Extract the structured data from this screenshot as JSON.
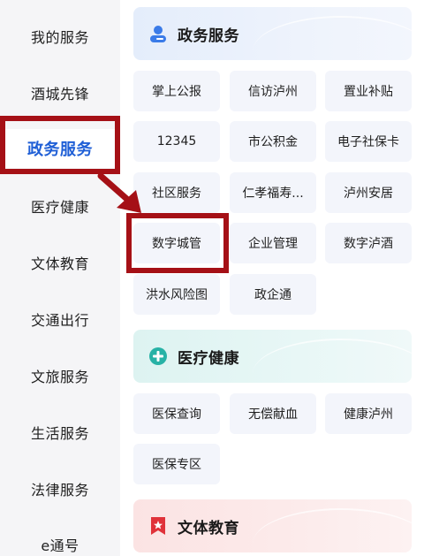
{
  "sidebar": {
    "items": [
      {
        "label": "我的服务"
      },
      {
        "label": "酒城先锋"
      },
      {
        "label": "政务服务"
      },
      {
        "label": "医疗健康"
      },
      {
        "label": "文体教育"
      },
      {
        "label": "交通出行"
      },
      {
        "label": "文旅服务"
      },
      {
        "label": "生活服务"
      },
      {
        "label": "法律服务"
      },
      {
        "label": "e通号"
      }
    ],
    "active_index": 2
  },
  "sections": {
    "gov": {
      "title": "政务服务",
      "icon": "person-icon",
      "items": [
        "掌上公报",
        "信访泸州",
        "置业补贴",
        "12345",
        "市公积金",
        "电子社保卡",
        "社区服务",
        "仁孝福寿...",
        "泸州安居",
        "数字城管",
        "企业管理",
        "数字泸酒",
        "洪水风险图",
        "政企通"
      ]
    },
    "med": {
      "title": "医疗健康",
      "icon": "medical-plus-icon",
      "items": [
        "医保查询",
        "无偿献血",
        "健康泸州",
        "医保专区"
      ]
    },
    "cul": {
      "title": "文体教育",
      "icon": "bookmark-star-icon"
    }
  },
  "colors": {
    "active_text": "#1f5fd6",
    "highlight_red": "#a51016",
    "gov_icon": "#3a7be8",
    "med_icon": "#27b2a6",
    "cul_icon": "#e0323a"
  }
}
